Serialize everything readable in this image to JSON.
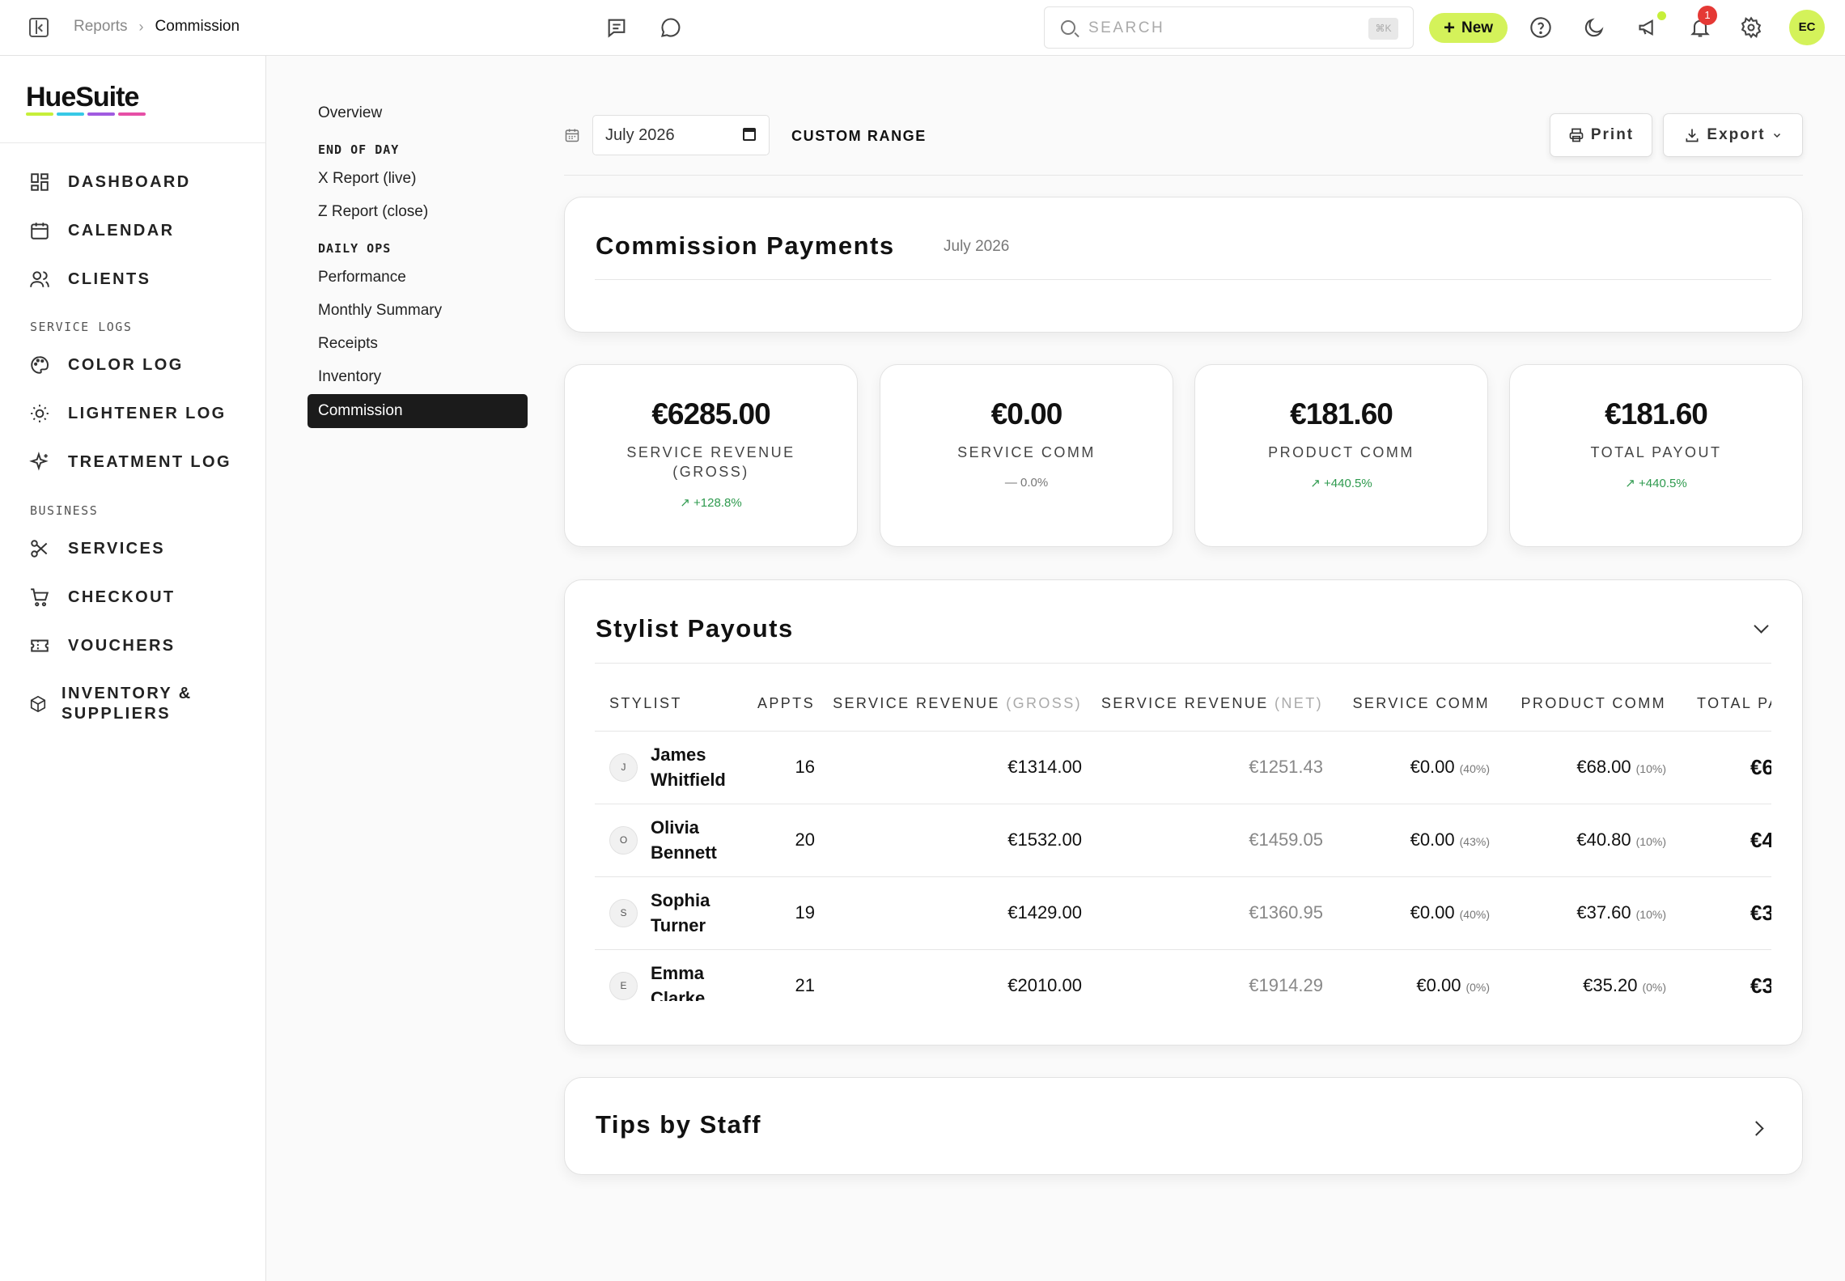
{
  "breadcrumb": {
    "parent": "Reports",
    "current": "Commission"
  },
  "search": {
    "placeholder": "SEARCH",
    "shortcut": "⌘K"
  },
  "header": {
    "new_label": "New",
    "notification_count": "1",
    "avatar_initials": "EC"
  },
  "brand": {
    "name": "HueSuite",
    "bar_colors": [
      "#c6ef3a",
      "#37c9e6",
      "#a05be0",
      "#e64fa6"
    ]
  },
  "sidebar": {
    "items": [
      {
        "label": "DASHBOARD",
        "icon": "dashboard-icon"
      },
      {
        "label": "CALENDAR",
        "icon": "calendar-icon"
      },
      {
        "label": "CLIENTS",
        "icon": "users-icon"
      }
    ],
    "service_logs_header": "SERVICE LOGS",
    "service_logs": [
      {
        "label": "COLOR LOG",
        "icon": "palette-icon"
      },
      {
        "label": "LIGHTENER LOG",
        "icon": "sun-icon"
      },
      {
        "label": "TREATMENT LOG",
        "icon": "sparkle-icon"
      }
    ],
    "business_header": "BUSINESS",
    "business": [
      {
        "label": "SERVICES",
        "icon": "scissors-icon"
      },
      {
        "label": "CHECKOUT",
        "icon": "cart-icon"
      },
      {
        "label": "VOUCHERS",
        "icon": "ticket-icon"
      },
      {
        "label_line1": "INVENTORY &",
        "label_line2": "SUPPLIERS",
        "icon": "box-icon"
      }
    ]
  },
  "subnav": {
    "overview": "Overview",
    "end_of_day_header": "END OF DAY",
    "end_of_day": [
      "X Report (live)",
      "Z Report (close)"
    ],
    "daily_ops_header": "DAILY OPS",
    "daily_ops": [
      "Performance",
      "Monthly Summary",
      "Receipts",
      "Inventory",
      "Commission"
    ]
  },
  "filter": {
    "date_value": "July 2026",
    "custom_range": "CUSTOM RANGE",
    "print_label": "Print",
    "export_label": "Export"
  },
  "commission_card": {
    "title": "Commission Payments",
    "period": "July 2026"
  },
  "kpis": [
    {
      "value": "€6285.00",
      "label_line1": "SERVICE REVENUE",
      "label_line2": "(GROSS)",
      "change": "+128.8%",
      "trend": "up"
    },
    {
      "value": "€0.00",
      "label_line1": "SERVICE COMM",
      "label_line2": "",
      "change": "0.0%",
      "trend": "flat"
    },
    {
      "value": "€181.60",
      "label_line1": "PRODUCT COMM",
      "label_line2": "",
      "change": "+440.5%",
      "trend": "up"
    },
    {
      "value": "€181.60",
      "label_line1": "TOTAL PAYOUT",
      "label_line2": "",
      "change": "+440.5%",
      "trend": "up"
    }
  ],
  "payouts": {
    "title": "Stylist Payouts",
    "columns": {
      "stylist": "STYLIST",
      "appts": "APPTS",
      "service_revenue": "SERVICE REVENUE",
      "gross": "(GROSS)",
      "net": "(NET)",
      "service_comm": "SERVICE COMM",
      "product_comm": "PRODUCT COMM",
      "total": "TOTAL PA"
    },
    "rows": [
      {
        "initial": "J",
        "first": "James",
        "last": "Whitfield",
        "appts": "16",
        "gross": "€1314.00",
        "net": "€1251.43",
        "service_comm": "€0.00",
        "service_pct": "(40%)",
        "product_comm": "€68.00",
        "product_pct": "(10%)",
        "total": "€6"
      },
      {
        "initial": "O",
        "first": "Olivia",
        "last": "Bennett",
        "appts": "20",
        "gross": "€1532.00",
        "net": "€1459.05",
        "service_comm": "€0.00",
        "service_pct": "(43%)",
        "product_comm": "€40.80",
        "product_pct": "(10%)",
        "total": "€4"
      },
      {
        "initial": "S",
        "first": "Sophia",
        "last": "Turner",
        "appts": "19",
        "gross": "€1429.00",
        "net": "€1360.95",
        "service_comm": "€0.00",
        "service_pct": "(40%)",
        "product_comm": "€37.60",
        "product_pct": "(10%)",
        "total": "€3"
      },
      {
        "initial": "E",
        "first": "Emma",
        "last": "Clarke",
        "appts": "21",
        "gross": "€2010.00",
        "net": "€1914.29",
        "service_comm": "€0.00",
        "service_pct": "(0%)",
        "product_comm": "€35.20",
        "product_pct": "(0%)",
        "total": "€3"
      }
    ]
  },
  "tips_card": {
    "title": "Tips by Staff"
  },
  "colors": {
    "accent": "#d4f25a",
    "positive": "#2e9a4e",
    "badge": "#e53935"
  }
}
